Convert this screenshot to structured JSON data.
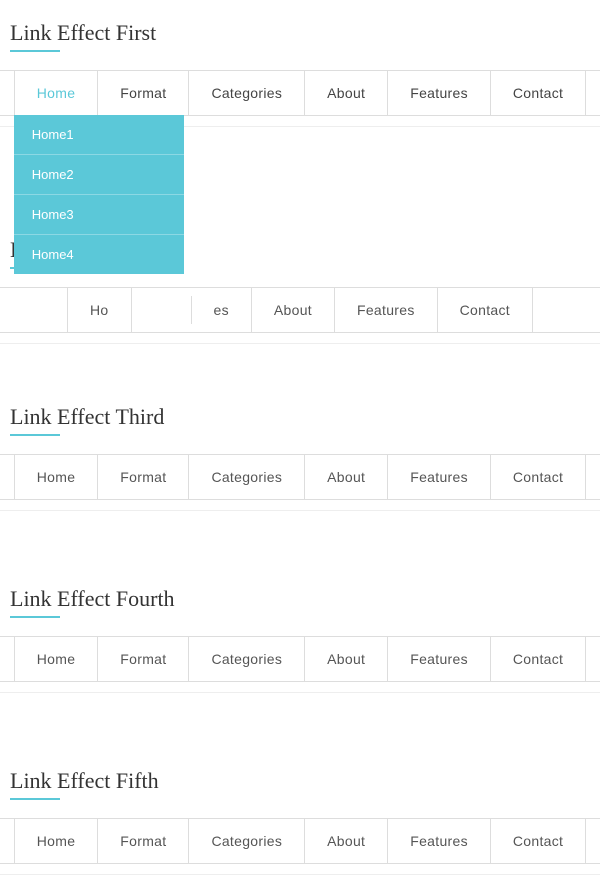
{
  "sections": [
    {
      "id": "first",
      "title": "Link Effect First",
      "nav": {
        "items": [
          {
            "label": "Home",
            "active": true
          },
          {
            "label": "Format",
            "active": false
          },
          {
            "label": "Categories",
            "active": false
          },
          {
            "label": "About",
            "active": false
          },
          {
            "label": "Features",
            "active": false
          },
          {
            "label": "Contact",
            "active": false
          }
        ],
        "dropdown": {
          "visible": true,
          "anchor": "Home",
          "items": [
            "Home1",
            "Home2",
            "Home3",
            "Home4"
          ]
        }
      }
    },
    {
      "id": "second",
      "title": "Link Effe",
      "nav": {
        "items": [
          {
            "label": "Ho",
            "active": false
          },
          {
            "label": "",
            "active": false
          },
          {
            "label": "es",
            "active": false
          },
          {
            "label": "About",
            "active": false
          },
          {
            "label": "Features",
            "active": false
          },
          {
            "label": "Contact",
            "active": false
          }
        ]
      }
    },
    {
      "id": "third",
      "title": "Link Effect Third",
      "nav": {
        "items": [
          {
            "label": "Home",
            "active": false
          },
          {
            "label": "Format",
            "active": false
          },
          {
            "label": "Categories",
            "active": false
          },
          {
            "label": "About",
            "active": false
          },
          {
            "label": "Features",
            "active": false
          },
          {
            "label": "Contact",
            "active": false
          }
        ]
      }
    },
    {
      "id": "fourth",
      "title": "Link Effect Fourth",
      "nav": {
        "items": [
          {
            "label": "Home",
            "active": false
          },
          {
            "label": "Format",
            "active": false
          },
          {
            "label": "Categories",
            "active": false
          },
          {
            "label": "About",
            "active": false
          },
          {
            "label": "Features",
            "active": false
          },
          {
            "label": "Contact",
            "active": false
          }
        ]
      }
    },
    {
      "id": "fifth",
      "title": "Link Effect Fifth",
      "nav": {
        "items": [
          {
            "label": "Home",
            "active": false
          },
          {
            "label": "Format",
            "active": false
          },
          {
            "label": "Categories",
            "active": false
          },
          {
            "label": "About",
            "active": false
          },
          {
            "label": "Features",
            "active": false
          },
          {
            "label": "Contact",
            "active": false
          }
        ]
      }
    }
  ],
  "dropdown_items": [
    "Home1",
    "Home2",
    "Home3",
    "Home4"
  ],
  "accent_color": "#5bc8d8"
}
